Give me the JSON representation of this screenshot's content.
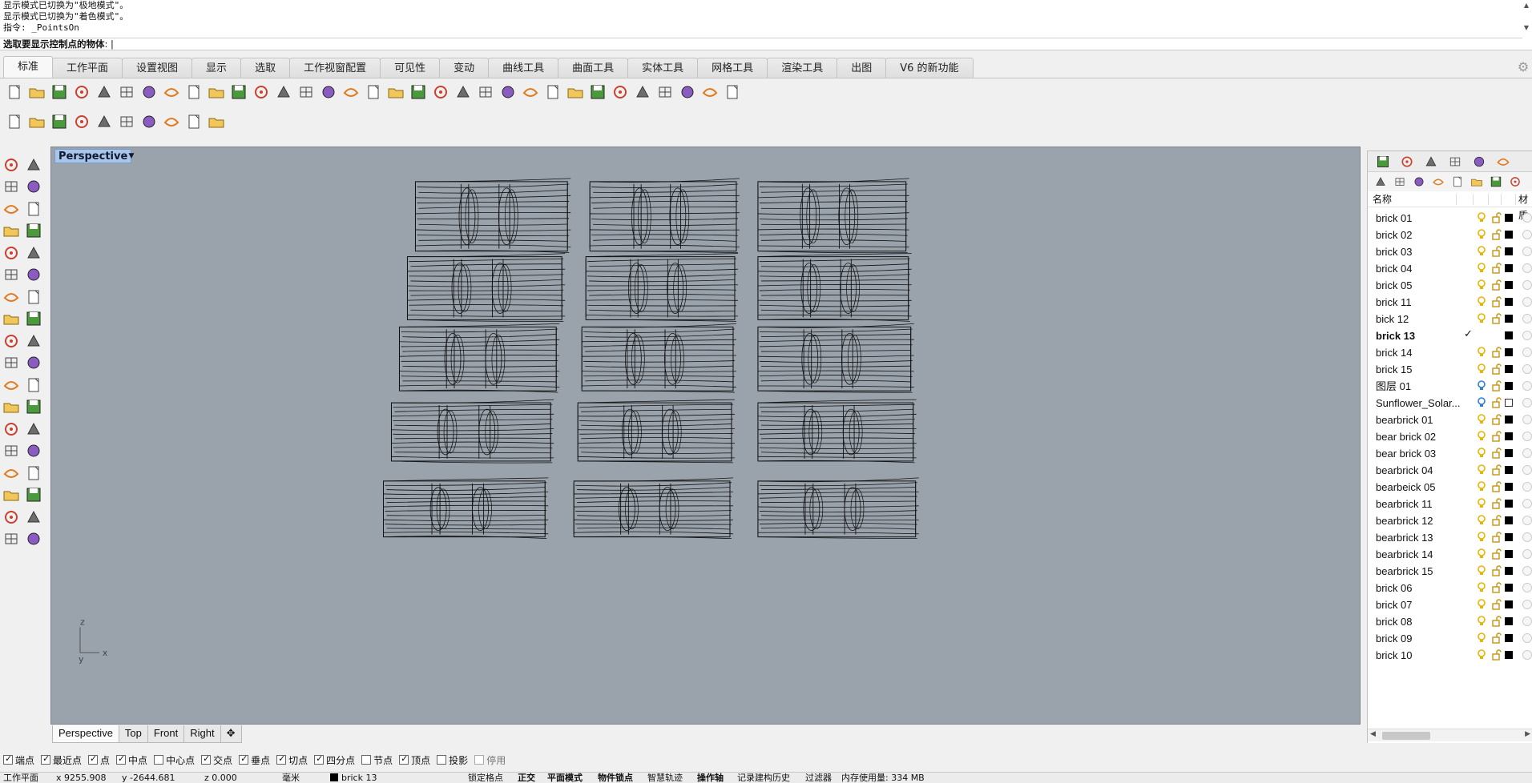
{
  "command": {
    "history": [
      "显示模式已切换为\"极地模式\"。",
      "显示模式已切换为\"着色模式\"。",
      "指令: _PointsOn"
    ],
    "prompt": "选取要显示控制点的物体",
    "prompt_suffix": ": |"
  },
  "tabs": [
    {
      "label": "标准",
      "active": true
    },
    {
      "label": "工作平面",
      "active": false
    },
    {
      "label": "设置视图",
      "active": false
    },
    {
      "label": "显示",
      "active": false
    },
    {
      "label": "选取",
      "active": false
    },
    {
      "label": "工作视窗配置",
      "active": false
    },
    {
      "label": "可见性",
      "active": false
    },
    {
      "label": "变动",
      "active": false
    },
    {
      "label": "曲线工具",
      "active": false
    },
    {
      "label": "曲面工具",
      "active": false
    },
    {
      "label": "实体工具",
      "active": false
    },
    {
      "label": "网格工具",
      "active": false
    },
    {
      "label": "渲染工具",
      "active": false
    },
    {
      "label": "出图",
      "active": false
    },
    {
      "label": "V6 的新功能",
      "active": false
    }
  ],
  "toolbar1_icons": [
    "new-icon",
    "open-icon",
    "save-icon",
    "print-icon",
    "import-icon",
    "cut-icon",
    "copy-icon",
    "paste-icon",
    "undo-icon",
    "pan-icon",
    "rotate-view-icon",
    "zoom-icon",
    "zoom-window-icon",
    "zoom-extents-icon",
    "zoom-selected-icon",
    "undo-view-icon",
    "four-viewports-icon",
    "car-icon",
    "named-view-icon",
    "named-cplane-icon",
    "camera-icon",
    "light-icon",
    "lock-icon",
    "layer-icon",
    "color-wheel-icon",
    "render-sphere-icon",
    "shaded-sphere-icon",
    "rendered-sphere-icon",
    "flag-icon",
    "options-icon",
    "grid-snap-icon",
    "globe-icon",
    "help-icon"
  ],
  "toolbar2_icons": [
    "check-icon",
    "teapot-icon",
    "box-view-icon",
    "frame-icon",
    "ghost-icon",
    "cube-icon",
    "hat-icon",
    "grass-icon",
    "drape-icon",
    "target-icon"
  ],
  "left_tools": [
    [
      "select-arrow-icon",
      "point-icon"
    ],
    [
      "polyline-icon",
      "curve-icon"
    ],
    [
      "circle-icon",
      "ellipse-icon"
    ],
    [
      "arc-icon",
      "rectangle-icon"
    ],
    [
      "polygon-icon",
      "fillet-curve-icon"
    ],
    [
      "surface-icon",
      "extrude-icon"
    ],
    [
      "box-solid-icon",
      "sphere-solid-icon"
    ],
    [
      "cylinder-icon",
      "mesh-icon"
    ],
    [
      "boolean-icon",
      "explode-icon"
    ],
    [
      "split-icon",
      "trim-icon"
    ],
    [
      "group-icon",
      "ungroup-icon"
    ],
    [
      "offset-icon",
      "blend-icon"
    ],
    [
      "text-icon",
      "scale-icon"
    ],
    [
      "array-icon",
      "dimension-icon"
    ],
    [
      "block-icon",
      "hatch-icon"
    ],
    [
      "array-grid-icon",
      "gumball-icon"
    ],
    [
      "paint-icon",
      "check-mark-icon"
    ],
    [
      "material-icon",
      "bucket-icon"
    ]
  ],
  "viewport": {
    "title": "Perspective",
    "axis_z": "z",
    "axis_x": "x",
    "axis_y": "y"
  },
  "viewport_tabs": [
    {
      "label": "Perspective",
      "active": true
    },
    {
      "label": "Top",
      "active": false
    },
    {
      "label": "Front",
      "active": false
    },
    {
      "label": "Right",
      "active": false
    },
    {
      "label": "✥",
      "active": false
    }
  ],
  "panel": {
    "tab_icons": [
      "color-wheel-icon",
      "layers-icon",
      "render-icon",
      "brush-icon",
      "folder-icon",
      "display-icon"
    ],
    "tool_icons": [
      "new-layer-icon",
      "new-sublayer-icon",
      "delete-layer-icon",
      "move-up-icon",
      "move-down-icon",
      "move-left-icon",
      "filter-icon",
      "tools-icon"
    ],
    "header_name": "名称",
    "header_mat": "材质",
    "layers": [
      {
        "name": "brick 01",
        "color": "black",
        "current": false,
        "bulb": "yellow"
      },
      {
        "name": "brick 02",
        "color": "black",
        "current": false,
        "bulb": "yellow"
      },
      {
        "name": "brick 03",
        "color": "black",
        "current": false,
        "bulb": "yellow"
      },
      {
        "name": "brick 04",
        "color": "black",
        "current": false,
        "bulb": "yellow"
      },
      {
        "name": "brick 05",
        "color": "black",
        "current": false,
        "bulb": "yellow"
      },
      {
        "name": "brick 11",
        "color": "black",
        "current": false,
        "bulb": "yellow"
      },
      {
        "name": "bick 12",
        "color": "black",
        "current": false,
        "bulb": "yellow"
      },
      {
        "name": "brick 13",
        "color": "black",
        "current": true,
        "bulb": "none"
      },
      {
        "name": "brick 14",
        "color": "black",
        "current": false,
        "bulb": "yellow"
      },
      {
        "name": "brick 15",
        "color": "black",
        "current": false,
        "bulb": "yellow"
      },
      {
        "name": "图层 01",
        "color": "black",
        "current": false,
        "bulb": "blue"
      },
      {
        "name": "Sunflower_Solar...",
        "color": "white",
        "current": false,
        "bulb": "blue"
      },
      {
        "name": "bearbrick 01",
        "color": "black",
        "current": false,
        "bulb": "yellow"
      },
      {
        "name": "bear brick 02",
        "color": "black",
        "current": false,
        "bulb": "yellow"
      },
      {
        "name": "bear brick 03",
        "color": "black",
        "current": false,
        "bulb": "yellow"
      },
      {
        "name": "bearbrick 04",
        "color": "black",
        "current": false,
        "bulb": "yellow"
      },
      {
        "name": "bearbeick 05",
        "color": "black",
        "current": false,
        "bulb": "yellow"
      },
      {
        "name": "bearbrick 11",
        "color": "black",
        "current": false,
        "bulb": "yellow"
      },
      {
        "name": "bearbrick 12",
        "color": "black",
        "current": false,
        "bulb": "yellow"
      },
      {
        "name": "bearbrick 13",
        "color": "black",
        "current": false,
        "bulb": "yellow"
      },
      {
        "name": "bearbrick 14",
        "color": "black",
        "current": false,
        "bulb": "yellow"
      },
      {
        "name": "bearbrick 15",
        "color": "black",
        "current": false,
        "bulb": "yellow"
      },
      {
        "name": "brick 06",
        "color": "black",
        "current": false,
        "bulb": "yellow"
      },
      {
        "name": "brick 07",
        "color": "black",
        "current": false,
        "bulb": "yellow"
      },
      {
        "name": "brick 08",
        "color": "black",
        "current": false,
        "bulb": "yellow"
      },
      {
        "name": "brick 09",
        "color": "black",
        "current": false,
        "bulb": "yellow"
      },
      {
        "name": "brick 10",
        "color": "black",
        "current": false,
        "bulb": "yellow"
      }
    ]
  },
  "snaps": [
    {
      "label": "端点",
      "checked": true,
      "enabled": true
    },
    {
      "label": "最近点",
      "checked": true,
      "enabled": true
    },
    {
      "label": "点",
      "checked": true,
      "enabled": true
    },
    {
      "label": "中点",
      "checked": true,
      "enabled": true
    },
    {
      "label": "中心点",
      "checked": false,
      "enabled": true
    },
    {
      "label": "交点",
      "checked": true,
      "enabled": true
    },
    {
      "label": "垂点",
      "checked": true,
      "enabled": true
    },
    {
      "label": "切点",
      "checked": true,
      "enabled": true
    },
    {
      "label": "四分点",
      "checked": true,
      "enabled": true
    },
    {
      "label": "节点",
      "checked": false,
      "enabled": true
    },
    {
      "label": "顶点",
      "checked": true,
      "enabled": true
    },
    {
      "label": "投影",
      "checked": false,
      "enabled": true
    },
    {
      "label": "停用",
      "checked": false,
      "enabled": false
    }
  ],
  "status": {
    "cplane": "工作平面",
    "x": "x 9255.908",
    "y": "y -2644.681",
    "z": "z 0.000",
    "units": "毫米",
    "layer": "brick 13",
    "grid_snap": "锁定格点",
    "ortho": "正交",
    "planar": "平面模式",
    "osnap": "物件锁点",
    "smarttrack": "智慧轨迹",
    "gumball": "操作轴",
    "history": "记录建构历史",
    "filter": "过滤器",
    "memory": "内存使用量: 334 MB"
  },
  "colors": {
    "viewport_bg": "#9aa3ac",
    "title_bg": "#a9c5ea",
    "bulb_yellow": "#e8b400",
    "bulb_blue": "#2f7fd6"
  }
}
